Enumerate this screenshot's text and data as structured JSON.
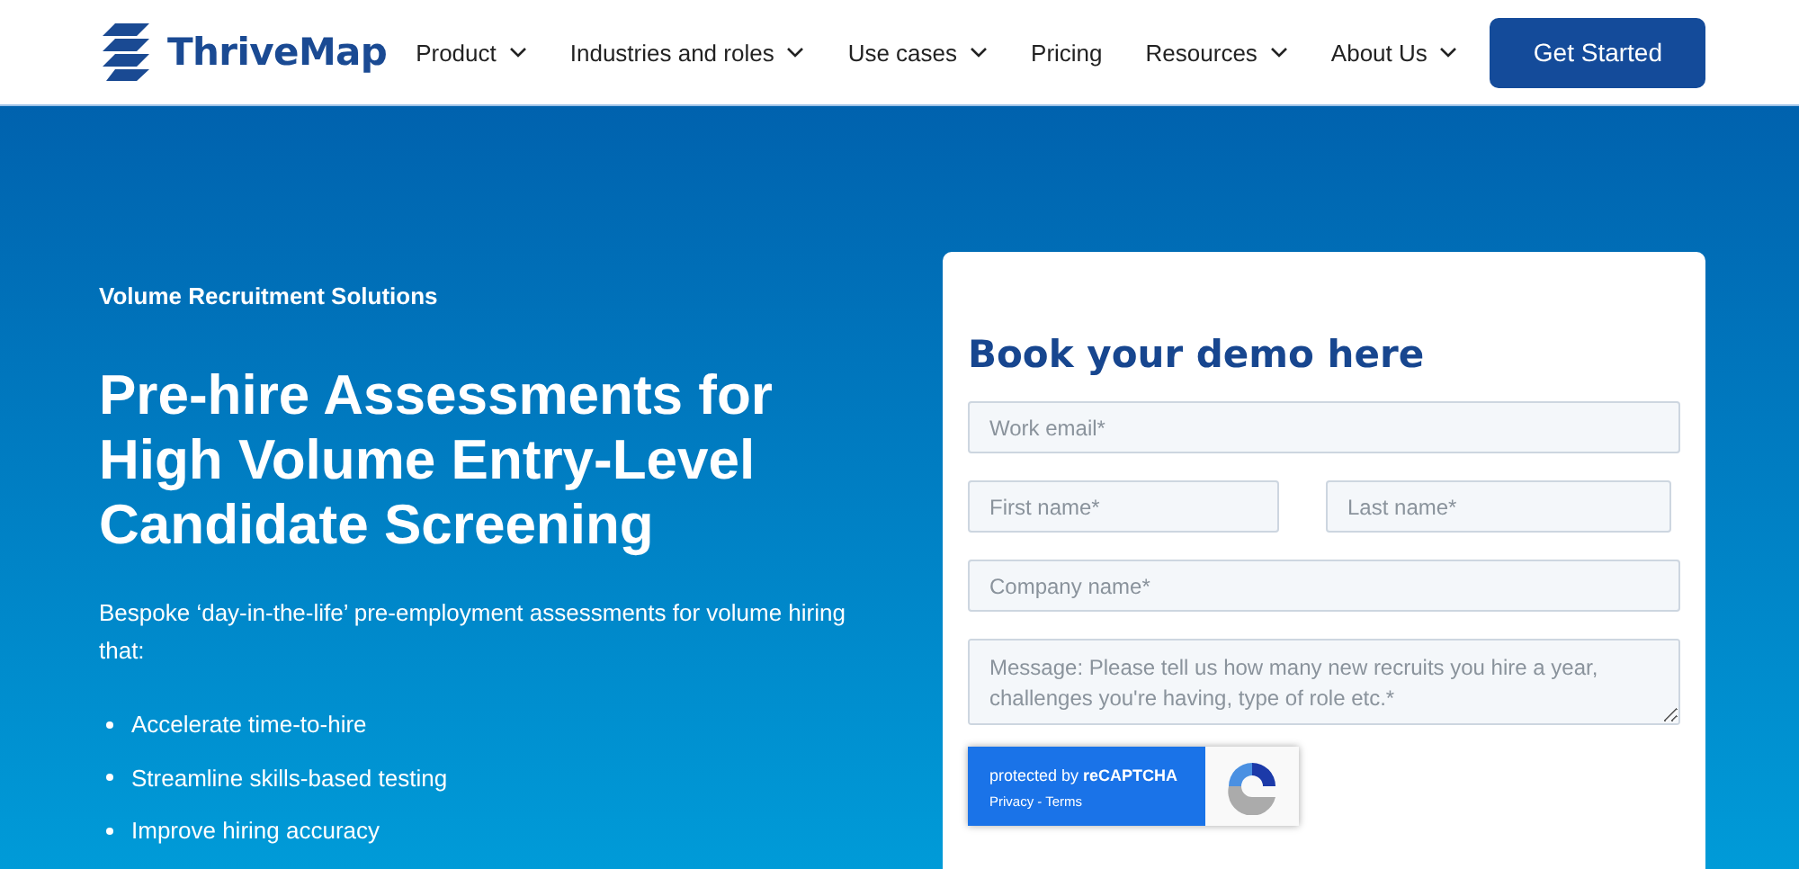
{
  "header": {
    "logo": "ThriveMap",
    "nav": [
      {
        "label": "Product",
        "dropdown": true
      },
      {
        "label": "Industries and roles",
        "dropdown": true
      },
      {
        "label": "Use cases",
        "dropdown": true
      },
      {
        "label": "Pricing",
        "dropdown": false
      },
      {
        "label": "Resources",
        "dropdown": true
      },
      {
        "label": "About Us",
        "dropdown": true
      }
    ],
    "cta": "Get Started"
  },
  "hero": {
    "eyebrow": "Volume Recruitment Solutions",
    "title": "Pre-hire Assessments for High Volume Entry-Level Candidate Screening",
    "intro": "Bespoke ‘day-in-the-life’ pre-employment assessments for volume hiring that:",
    "bullets": [
      "Accelerate time-to-hire",
      "Streamline skills-based testing",
      "Improve hiring accuracy"
    ]
  },
  "form": {
    "title": "Book your demo here",
    "rows": [
      [
        {
          "placeholder": "Work email*",
          "kind": "input"
        }
      ],
      [
        {
          "placeholder": "First name*",
          "kind": "input"
        },
        {
          "placeholder": "Last name*",
          "kind": "input"
        }
      ],
      [
        {
          "placeholder": "Company name*",
          "kind": "input"
        }
      ],
      [
        {
          "placeholder": "Message: Please tell us how many new recruits you hire a year, challenges you're having, type of role etc.*",
          "kind": "textarea"
        }
      ]
    ],
    "recaptcha": {
      "label": "protected by ",
      "brand": "reCAPTCHA",
      "privacy": "Privacy",
      "separator": " - ",
      "terms": "Terms"
    }
  }
}
